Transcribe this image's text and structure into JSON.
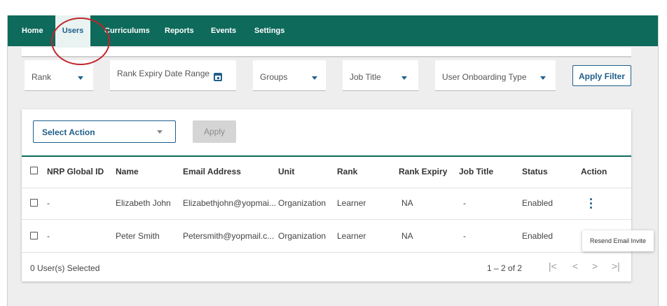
{
  "nav": {
    "items": [
      "Home",
      "Users",
      "Curriculums",
      "Reports",
      "Events",
      "Settings"
    ],
    "active": "Users"
  },
  "filters": {
    "rank": "Rank",
    "rank_expiry": "Rank Expiry Date Range",
    "groups": "Groups",
    "job_title": "Job Title",
    "onboarding": "User Onboarding Type",
    "apply_label": "Apply Filter"
  },
  "bulk": {
    "select_action": "Select Action",
    "apply_label": "Apply"
  },
  "table": {
    "columns": [
      "NRP Global ID",
      "Name",
      "Email Address",
      "Unit",
      "Rank",
      "Rank Expiry",
      "Job Title",
      "Status",
      "Action"
    ],
    "rows": [
      {
        "nrp_id": "-",
        "name": "Elizabeth John",
        "email": "Elizabethjohn@yopmai...",
        "unit": "Organization",
        "rank": "Learner",
        "rank_expiry": "NA",
        "job_title": "-",
        "status": "Enabled"
      },
      {
        "nrp_id": "-",
        "name": "Peter Smith",
        "email": "Petersmith@yopmail.c...",
        "unit": "Organization",
        "rank": "Learner",
        "rank_expiry": "NA",
        "job_title": "-",
        "status": "Enabled"
      }
    ]
  },
  "footer": {
    "selected": "0 User(s) Selected",
    "range": "1 – 2 of 2",
    "pager": {
      "first": "|<",
      "prev": "<",
      "next": ">",
      "last": ">|"
    }
  },
  "tooltip": {
    "text": "Resend Email Invite"
  },
  "colors": {
    "brand": "#0e6a5b",
    "accent": "#1f5f8b",
    "highlight": "#c0262c"
  }
}
